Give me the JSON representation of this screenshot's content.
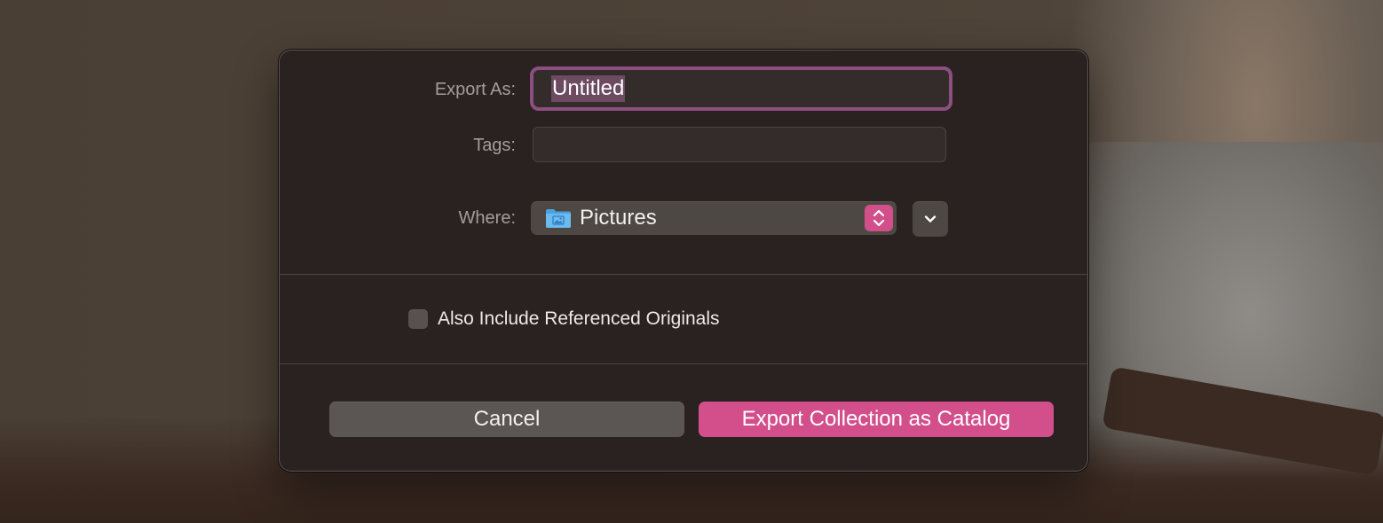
{
  "dialog": {
    "export_as_label": "Export As:",
    "export_as_value": "Untitled",
    "tags_label": "Tags:",
    "tags_value": "",
    "where_label": "Where:",
    "where_value": "Pictures",
    "where_icon": "folder-pictures-icon",
    "include_originals_label": "Also Include Referenced Originals",
    "include_originals_checked": false,
    "cancel_label": "Cancel",
    "export_label": "Export Collection as Catalog"
  },
  "colors": {
    "accent": "#d24f8b",
    "focus_ring": "#8c4f80",
    "dialog_bg": "#2a2220",
    "control_bg": "#4e4845"
  }
}
